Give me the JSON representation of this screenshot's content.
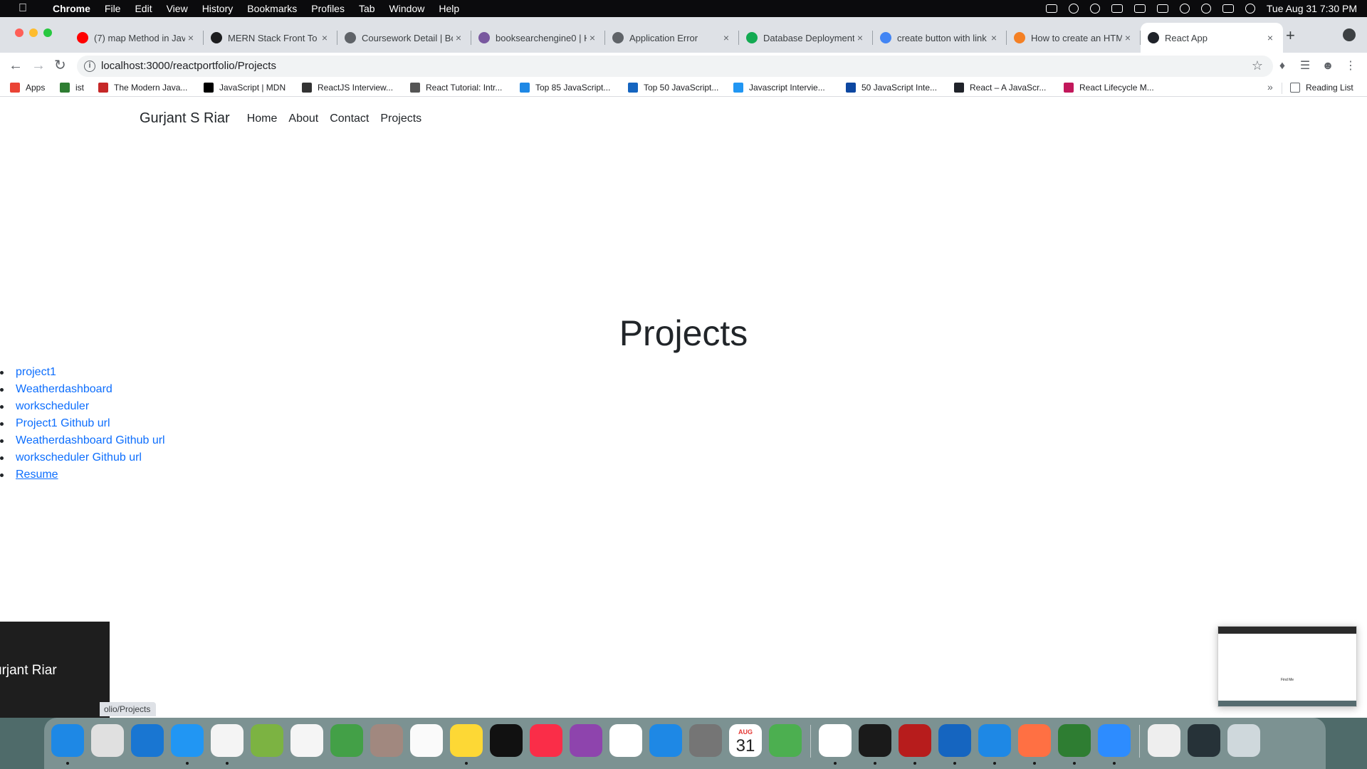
{
  "menubar": {
    "app_name": "Chrome",
    "items": [
      "File",
      "Edit",
      "View",
      "History",
      "Bookmarks",
      "Profiles",
      "Tab",
      "Window",
      "Help"
    ],
    "clock": "Tue Aug 31  7:30 PM"
  },
  "tabs": [
    {
      "title": "(7) map Method in Jav",
      "icon": "youtube-icon",
      "color": "#ff0000"
    },
    {
      "title": "MERN Stack Front To E",
      "icon": "udemy-icon",
      "color": "#1c1d1f"
    },
    {
      "title": "Coursework Detail | Bo",
      "icon": "globe-icon",
      "color": "#5f6368"
    },
    {
      "title": "booksearchengine0 | H",
      "icon": "heroku-icon",
      "color": "#79589f"
    },
    {
      "title": "Application Error",
      "icon": "globe-icon",
      "color": "#5f6368"
    },
    {
      "title": "Database Deployment",
      "icon": "mongodb-icon",
      "color": "#13aa52"
    },
    {
      "title": "create button with link",
      "icon": "google-icon",
      "color": "#4285f4"
    },
    {
      "title": "How to create an HTM",
      "icon": "stackoverflow-icon",
      "color": "#f48024"
    },
    {
      "title": "React App",
      "icon": "react-icon",
      "color": "#20232a",
      "active": true
    }
  ],
  "toolbar": {
    "url": "localhost:3000/reactportfolio/Projects"
  },
  "bookmarks": {
    "items": [
      {
        "label": "Apps",
        "icon": "apps-grid-icon",
        "color": "#ea4335"
      },
      {
        "label": "ist",
        "icon": "x-icon",
        "color": "#2e7d32"
      },
      {
        "label": "The Modern Java...",
        "icon": "js-info-icon",
        "color": "#c62828"
      },
      {
        "label": "JavaScript | MDN",
        "icon": "mdn-icon",
        "color": "#000000"
      },
      {
        "label": "ReactJS Interview...",
        "icon": "circle-x-icon",
        "color": "#333333"
      },
      {
        "label": "React Tutorial: Intr...",
        "icon": "react-icon",
        "color": "#555555"
      },
      {
        "label": "Top 85 JavaScript...",
        "icon": "edureka-icon",
        "color": "#1e88e5"
      },
      {
        "label": "Top 50 JavaScript...",
        "icon": "e-icon",
        "color": "#1565c0"
      },
      {
        "label": "Javascript Intervie...",
        "icon": "ib-icon",
        "color": "#2196f3"
      },
      {
        "label": "50 JavaScript Inte...",
        "icon": "h-icon",
        "color": "#0d47a1"
      },
      {
        "label": "React – A JavaScr...",
        "icon": "react-icon",
        "color": "#20232a"
      },
      {
        "label": "React Lifecycle M...",
        "icon": "heart-icon",
        "color": "#c2185b"
      }
    ],
    "more": "»",
    "reading_list": "Reading List"
  },
  "site": {
    "brand": "Gurjant S Riar",
    "nav": [
      "Home",
      "About",
      "Contact",
      "Projects"
    ],
    "title": "Projects",
    "projects": [
      "project1",
      "Weatherdashboard",
      "workscheduler",
      "Project1 Github url",
      "Weatherdashboard Github url",
      "workscheduler Github url",
      "Resume"
    ]
  },
  "overlay": {
    "text": "urjant Riar",
    "status_url": "olio/Projects"
  },
  "thumbnail": {
    "text": "Find Me"
  },
  "dock": {
    "date_month": "AUG",
    "date_day": "31",
    "apps": [
      {
        "name": "finder-icon",
        "color": "#1e88e5"
      },
      {
        "name": "launchpad-icon",
        "color": "#e0e0e0"
      },
      {
        "name": "safari-icon",
        "color": "#1976d2"
      },
      {
        "name": "mail-icon",
        "color": "#2196f3"
      },
      {
        "name": "chrome-icon",
        "color": "#f4f4f4"
      },
      {
        "name": "maps-icon",
        "color": "#7cb342"
      },
      {
        "name": "photos-icon",
        "color": "#f5f5f5"
      },
      {
        "name": "facetime-icon",
        "color": "#43a047"
      },
      {
        "name": "contacts-icon",
        "color": "#a1887f"
      },
      {
        "name": "reminders-icon",
        "color": "#fafafa"
      },
      {
        "name": "notes-icon",
        "color": "#fdd835"
      },
      {
        "name": "appletv-icon",
        "color": "#111111"
      },
      {
        "name": "music-icon",
        "color": "#fa2d48"
      },
      {
        "name": "podcasts-icon",
        "color": "#8e44ad"
      },
      {
        "name": "news-icon",
        "color": "#ffffff"
      },
      {
        "name": "appstore-icon",
        "color": "#1e88e5"
      },
      {
        "name": "system-preferences-icon",
        "color": "#757575"
      },
      {
        "name": "calendar-icon",
        "color": "#ffffff"
      },
      {
        "name": "messages-icon",
        "color": "#4caf50"
      },
      {
        "name": "slack-icon",
        "color": "#ffffff"
      },
      {
        "name": "terminal-icon",
        "color": "#1a1a1a"
      },
      {
        "name": "acrobat-icon",
        "color": "#b71c1c"
      },
      {
        "name": "word-icon",
        "color": "#1565c0"
      },
      {
        "name": "vscode-icon",
        "color": "#1e88e5"
      },
      {
        "name": "pages-icon",
        "color": "#ff7043"
      },
      {
        "name": "excel-icon",
        "color": "#2e7d32"
      },
      {
        "name": "zoom-icon",
        "color": "#2d8cff"
      },
      {
        "name": "document-icon",
        "color": "#eeeeee"
      },
      {
        "name": "terminal-window-icon",
        "color": "#263238"
      },
      {
        "name": "trash-icon",
        "color": "#cfd8dc"
      }
    ]
  }
}
